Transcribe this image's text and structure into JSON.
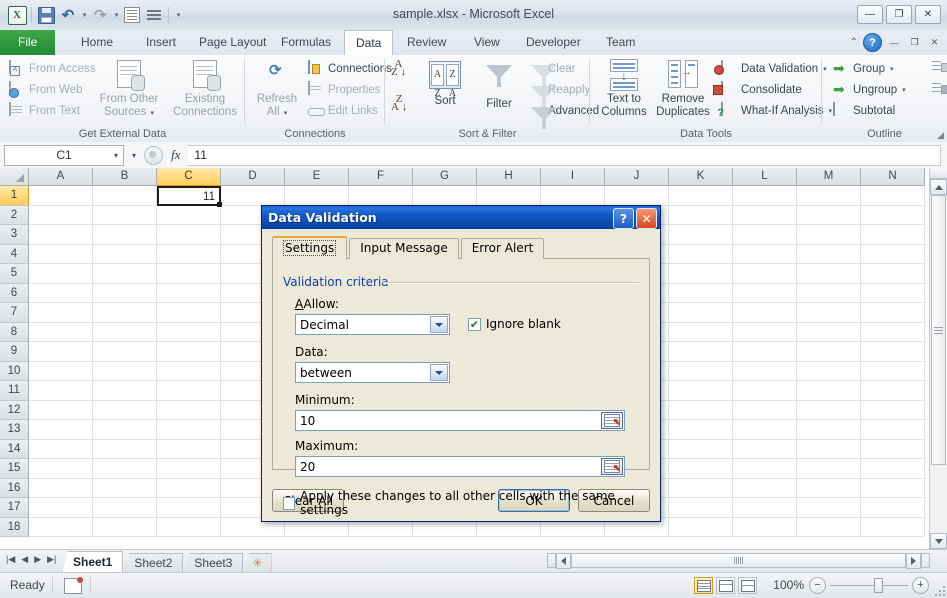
{
  "window": {
    "title": "sample.xlsx  -  Microsoft Excel",
    "minimize": "—",
    "restore": "❐",
    "close": "✕"
  },
  "quick_access": {
    "excel_logo": "X",
    "save": "save-icon",
    "undo": "↰",
    "redo": "↰",
    "undo_caret": "▾",
    "redo_caret": "▾",
    "more_caret": "▾"
  },
  "ribbon": {
    "tabs": [
      {
        "label": "File",
        "active": false,
        "file": true
      },
      {
        "label": "Home",
        "active": false
      },
      {
        "label": "Insert",
        "active": false
      },
      {
        "label": "Page Layout",
        "active": false
      },
      {
        "label": "Formulas",
        "active": false
      },
      {
        "label": "Data",
        "active": true
      },
      {
        "label": "Review",
        "active": false
      },
      {
        "label": "View",
        "active": false
      },
      {
        "label": "Developer",
        "active": false
      },
      {
        "label": "Team",
        "active": false
      }
    ],
    "help_chevron": "⌃",
    "help": "?",
    "min_ribbon": "—",
    "restore_ribbon": "❐",
    "close_ribbon": "✕",
    "groups": [
      {
        "name": "Get External Data",
        "items": [
          "From Access",
          "From Web",
          "From Text",
          "From Other Sources",
          "Existing Connections"
        ],
        "from_other_sources": "From Other\nSources",
        "from_other_line1": "From Other",
        "from_other_line2": "Sources",
        "existing_line1": "Existing",
        "existing_line2": "Connections",
        "caret": "▾"
      },
      {
        "name": "Connections",
        "refresh_line1": "Refresh",
        "refresh_line2": "All",
        "connections": "Connections",
        "properties": "Properties",
        "edit_links": "Edit Links",
        "caret": "▾"
      },
      {
        "name": "Sort & Filter",
        "sort": "Sort",
        "filter": "Filter",
        "clear": "Clear",
        "reapply": "Reapply",
        "advanced": "Advanced",
        "az": "A\nZ",
        "za": "Z\nA"
      },
      {
        "name": "Data Tools",
        "text_to_columns_1": "Text to",
        "text_to_columns_2": "Columns",
        "remove_dup_1": "Remove",
        "remove_dup_2": "Duplicates",
        "data_validation": "Data Validation",
        "consolidate": "Consolidate",
        "what_if": "What-If Analysis",
        "caret": "▾"
      },
      {
        "name": "Outline",
        "group": "Group",
        "ungroup": "Ungroup",
        "subtotal": "Subtotal",
        "caret": "▾",
        "launcher": "◢"
      }
    ]
  },
  "formula_bar": {
    "name_box": "C1",
    "name_caret": "▾",
    "fx": "fx",
    "cancel_caret": "▾",
    "value": "11"
  },
  "grid": {
    "columns": [
      "A",
      "B",
      "C",
      "D",
      "E",
      "F",
      "G",
      "H",
      "I",
      "J",
      "K",
      "L",
      "M",
      "N"
    ],
    "selected_column": "C",
    "rows": [
      "1",
      "2",
      "3",
      "4",
      "5",
      "6",
      "7",
      "8",
      "9",
      "10",
      "11",
      "12",
      "13",
      "14",
      "15",
      "16",
      "17",
      "18"
    ],
    "selected_row": "1",
    "active_cell": {
      "ref": "C1",
      "value": "11",
      "col_index": 2,
      "row_index": 0
    }
  },
  "sheet_tabs": {
    "nav": [
      "|◀",
      "◀",
      "▶",
      "▶|"
    ],
    "tabs": [
      {
        "label": "Sheet1",
        "active": true
      },
      {
        "label": "Sheet2",
        "active": false
      },
      {
        "label": "Sheet3",
        "active": false
      }
    ],
    "new_sheet": "✳"
  },
  "status_bar": {
    "mode": "Ready",
    "macro_record": "record-macro-icon",
    "view_normal": "normal-view",
    "view_layout": "page-layout-view",
    "view_break": "page-break-view",
    "zoom": "100%",
    "zoom_out": "−",
    "zoom_in": "+"
  },
  "dialog": {
    "title": "Data Validation",
    "help_btn": "?",
    "close_btn": "✕",
    "tabs": [
      {
        "label": "Settings",
        "active": true
      },
      {
        "label": "Input Message",
        "active": false
      },
      {
        "label": "Error Alert",
        "active": false
      }
    ],
    "legend": "Validation criteria",
    "allow_label": "Allow:",
    "allow_value": "Decimal",
    "ignore_blank_label": "Ignore blank",
    "ignore_blank_checked": true,
    "ignore_blank_mark": "✔",
    "data_label": "Data:",
    "data_value": "between",
    "minimum_label": "Minimum:",
    "minimum_value": "10",
    "maximum_label": "Maximum:",
    "maximum_value": "20",
    "apply_all_label": "Apply these changes to all other cells with the same settings",
    "apply_all_checked": false,
    "clear_all": "Clear All",
    "ok": "OK",
    "cancel": "Cancel",
    "range_picker": "range-selector-icon"
  },
  "colors": {
    "title_blue": "#0a47a8",
    "file_green": "#218a34",
    "selection_gold": "#ffcd5e",
    "dialog_face": "#ece9d8",
    "legend_blue": "#0a3fa8"
  }
}
